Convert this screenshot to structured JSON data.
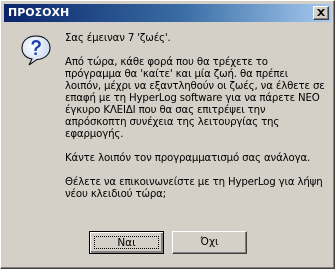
{
  "window": {
    "title": "ΠΡΟΣΟΧΗ"
  },
  "icons": {
    "dialog_icon": "question-icon",
    "close_icon": "close-icon"
  },
  "message": {
    "line1": "Σας έμειναν 7 'ζωές'.",
    "line2": "Από τώρα, κάθε φορά που θα τρέχετε το πρόγραμμα θα 'καίτε' και μία ζωή. θα πρέπει λοιπόν, μέχρι να εξαντληθούν οι ζωές, να έλθετε σε επαφή με τη HyperLog software για να πάρετε ΝΕΟ έγκυρο ΚΛΕΙΔΙ που θα σας επιτρέψει την απρόσκοπτη συνέχεια της λειτουργίας της εφαρμογής.",
    "line3": "Κάντε λοιπόν τον προγραμματισμό σας ανάλογα.",
    "line4": "Θέλετε να επικοινωνείστε με τη HyperLog για λήψη νέου κλειδιού τώρα;"
  },
  "buttons": {
    "yes_label": "Ναι",
    "no_label": "Όχι"
  }
}
